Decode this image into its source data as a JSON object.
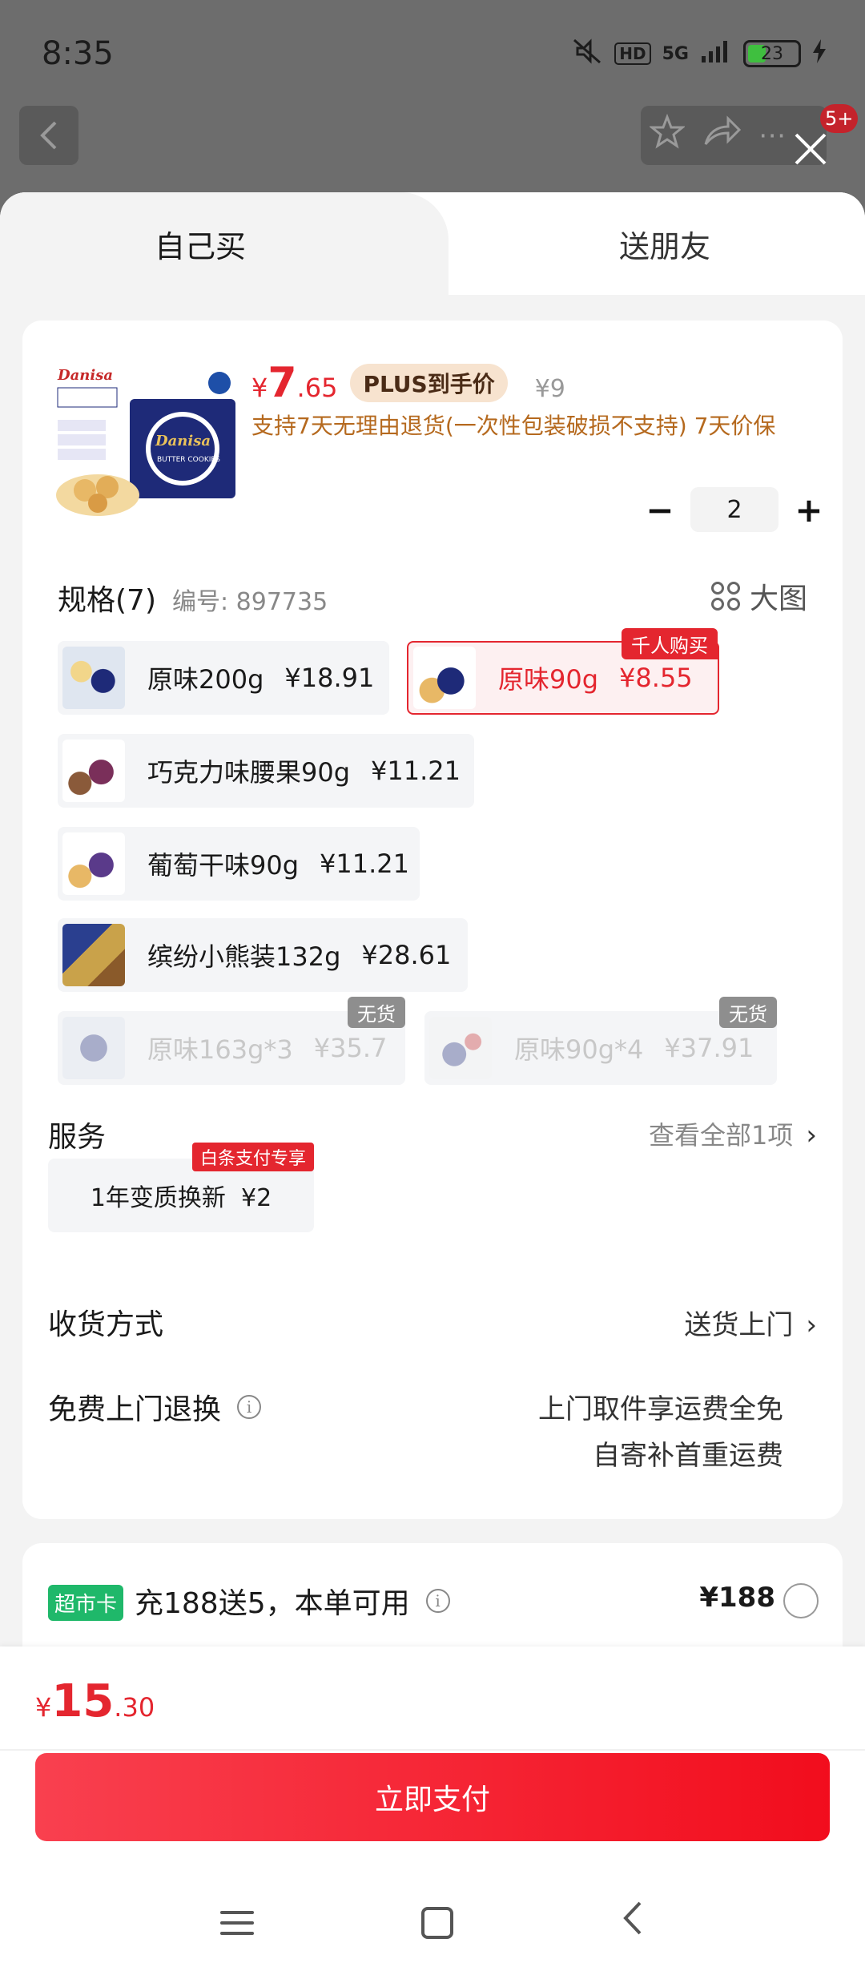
{
  "status_bar": {
    "time": "8:35",
    "hd": "HD",
    "network": "5G",
    "battery": "23"
  },
  "header": {
    "back_icon": "chevron-left-icon",
    "more_badge": "5+"
  },
  "tabs": [
    {
      "label": "自己买",
      "active": true
    },
    {
      "label": "送朋友",
      "active": false
    }
  ],
  "product": {
    "price_symbol": "¥",
    "price_int": "7",
    "price_dec": ".65",
    "plus_label": "PLUS到手价",
    "original_price": "¥9",
    "policy": "支持7天无理由退货(一次性包装破损不支持) 7天价保",
    "quantity": "2",
    "minus": "−",
    "plus": "+"
  },
  "spec": {
    "title": "规格(7)",
    "code": "编号: 897735",
    "big_pic": "大图",
    "options": [
      {
        "name": "原味200g",
        "price": "¥18.91",
        "state": "normal",
        "tag": ""
      },
      {
        "name": "原味90g",
        "price": "¥8.55",
        "state": "selected",
        "tag": "千人购买"
      },
      {
        "name": "巧克力味腰果90g",
        "price": "¥11.21",
        "state": "normal",
        "tag": ""
      },
      {
        "name": "葡萄干味90g",
        "price": "¥11.21",
        "state": "normal",
        "tag": ""
      },
      {
        "name": "缤纷小熊装132g",
        "price": "¥28.61",
        "state": "normal",
        "tag": ""
      },
      {
        "name": "原味163g*3",
        "price": "¥35.7",
        "state": "disabled",
        "tag": "无货"
      },
      {
        "name": "原味90g*4",
        "price": "¥37.91",
        "state": "disabled",
        "tag": "无货"
      }
    ]
  },
  "service": {
    "title": "服务",
    "view_all": "查看全部1项",
    "item": "1年变质换新  ¥2",
    "item_tag": "白条支付专享"
  },
  "delivery": {
    "title": "收货方式",
    "value": "送货上门"
  },
  "free_return": {
    "title": "免费上门退换",
    "line1": "上门取件享运费全免",
    "line2": "自寄补首重运费"
  },
  "supermarket": {
    "tag": "超市卡",
    "text": "充188送5，本单可用",
    "price": "¥188"
  },
  "checkout": {
    "symbol": "¥",
    "total_int": "15",
    "total_dec": ".30",
    "pay_label": "立即支付"
  },
  "colors": {
    "accent": "#e4262f",
    "policy": "#b5691e",
    "supermarket": "#1fb86a"
  }
}
